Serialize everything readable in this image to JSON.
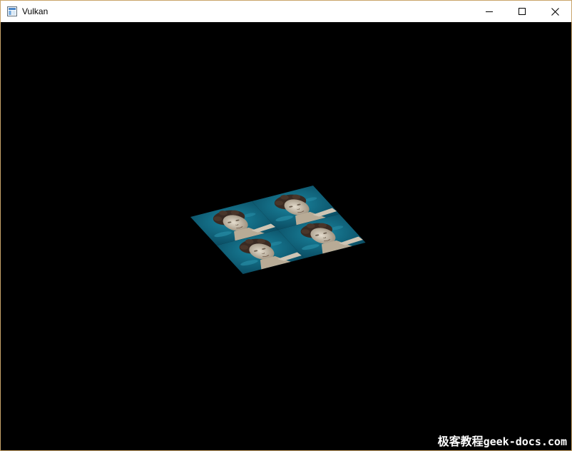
{
  "window": {
    "title": "Vulkan",
    "icon": "app-window-icon",
    "border_color": "#c9a46a"
  },
  "caption_buttons": {
    "minimize_icon": "minimize-icon",
    "maximize_icon": "maximize-icon",
    "close_icon": "close-icon"
  },
  "viewport": {
    "background": "#000000",
    "scene": {
      "description_icon": "textured-quad",
      "tiles": 4,
      "texture_colors": {
        "sky": "#0f6f88",
        "sky_dark": "#0a4f66",
        "statue": "#cfc5b4"
      }
    }
  },
  "watermark": {
    "cn_text": "极客教程",
    "url_text": "geek-docs.com"
  }
}
